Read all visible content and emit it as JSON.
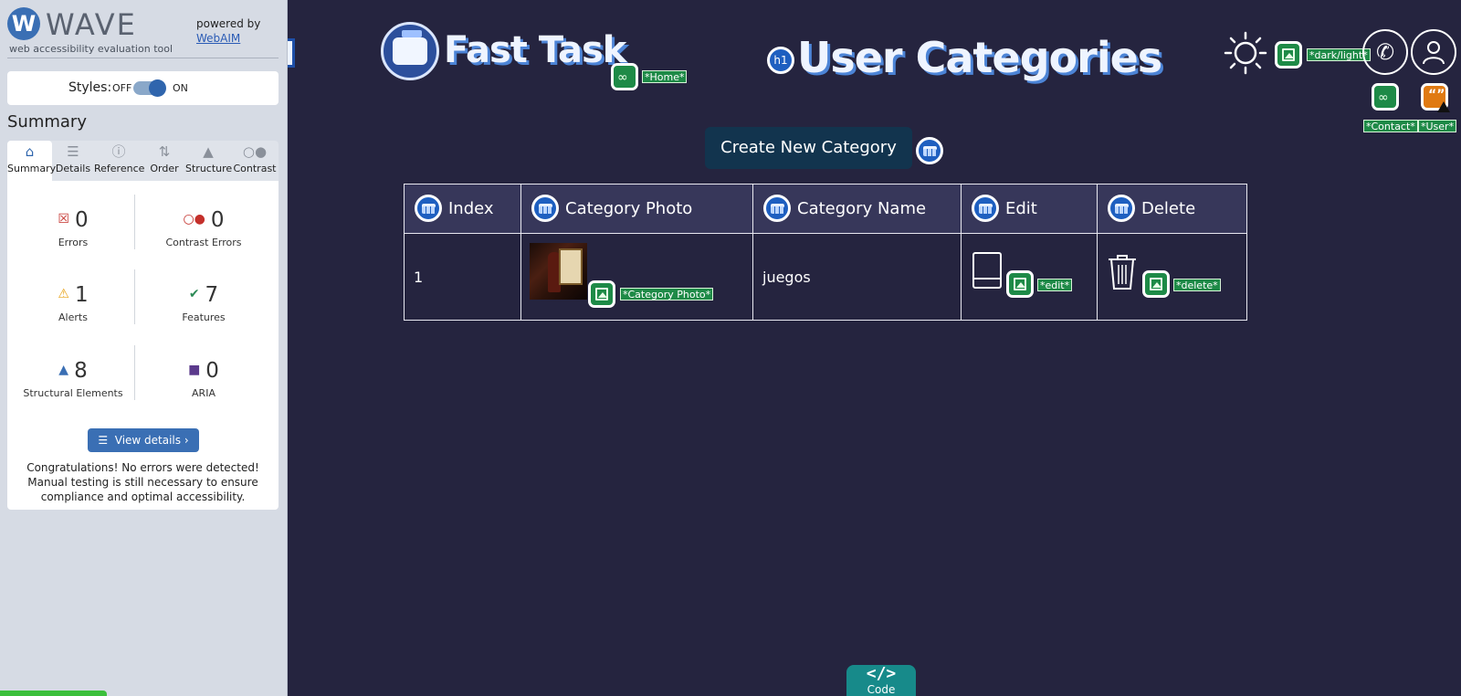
{
  "wave": {
    "logo_glyph": "W",
    "brand": "WAVE",
    "tagline": "web accessibility evaluation tool",
    "powered_by": "powered by",
    "webaim_link": "WebAIM",
    "styles_label": "Styles:",
    "styles_off": "OFF",
    "styles_on": "ON",
    "summary_title": "Summary",
    "tabs": [
      {
        "label": "Summary",
        "icon": "home-icon"
      },
      {
        "label": "Details",
        "icon": "list-icon"
      },
      {
        "label": "Reference",
        "icon": "info-icon"
      },
      {
        "label": "Order",
        "icon": "order-icon"
      },
      {
        "label": "Structure",
        "icon": "structure-icon"
      },
      {
        "label": "Contrast",
        "icon": "contrast-icon"
      }
    ],
    "stats": {
      "errors": {
        "count": "0",
        "label": "Errors"
      },
      "contrast_errors": {
        "count": "0",
        "label": "Contrast Errors"
      },
      "alerts": {
        "count": "1",
        "label": "Alerts"
      },
      "features": {
        "count": "7",
        "label": "Features"
      },
      "structural": {
        "count": "8",
        "label": "Structural Elements"
      },
      "aria": {
        "count": "0",
        "label": "ARIA"
      }
    },
    "view_details": "View details ›",
    "congrats": "Congratulations! No errors were detected! Manual testing is still necessary to ensure compliance and optimal accessibility."
  },
  "page": {
    "brand_title": "Fast Task",
    "home_label": "*Home*",
    "h1_badge": "h1",
    "heading": "User Categories",
    "darklight_label": "*dark/light*",
    "contact_label": "*Contact*",
    "user_label": "*User*",
    "create_button": "Create New Category",
    "table": {
      "headers": [
        "Index",
        "Category Photo",
        "Category Name",
        "Edit",
        "Delete"
      ],
      "rows": [
        {
          "index": "1",
          "photo_label": "*Category Photo*",
          "name": "juegos",
          "edit_label": "*edit*",
          "delete_label": "*delete*"
        }
      ]
    },
    "code_tab": {
      "symbol": "</>",
      "label": "Code"
    }
  },
  "colors": {
    "page_bg": "#25243f",
    "sidebar_bg": "#d6dbe4",
    "wave_blue": "#3a6fb4",
    "badge_green": "#1e8a47",
    "table_badge_blue": "#1e5fc0",
    "create_button_bg": "#12344e",
    "code_tab_bg": "#178a8a"
  }
}
